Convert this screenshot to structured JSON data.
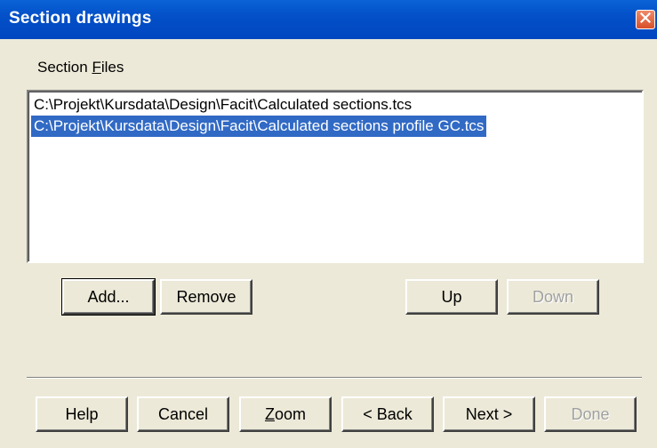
{
  "window": {
    "title": "Section drawings"
  },
  "section_files": {
    "label_prefix": "Section ",
    "label_mnemonic": "F",
    "label_suffix": "iles",
    "items": [
      {
        "path": "C:\\Projekt\\Kursdata\\Design\\Facit\\Calculated sections.tcs",
        "selected": false
      },
      {
        "path": "C:\\Projekt\\Kursdata\\Design\\Facit\\Calculated sections profile GC.tcs",
        "selected": true
      }
    ]
  },
  "list_buttons": {
    "add": "Add...",
    "remove": "Remove",
    "up": "Up",
    "down": "Down"
  },
  "footer_buttons": {
    "help": "Help",
    "cancel": "Cancel",
    "zoom_mnemonic": "Z",
    "zoom_rest": "oom",
    "back": "< Back",
    "next": "Next >",
    "done": "Done"
  },
  "colors": {
    "titlebar": "#0350c8",
    "selection": "#316ac5",
    "dialog_bg": "#ece9d8"
  },
  "icons": {
    "close": "close-icon"
  }
}
